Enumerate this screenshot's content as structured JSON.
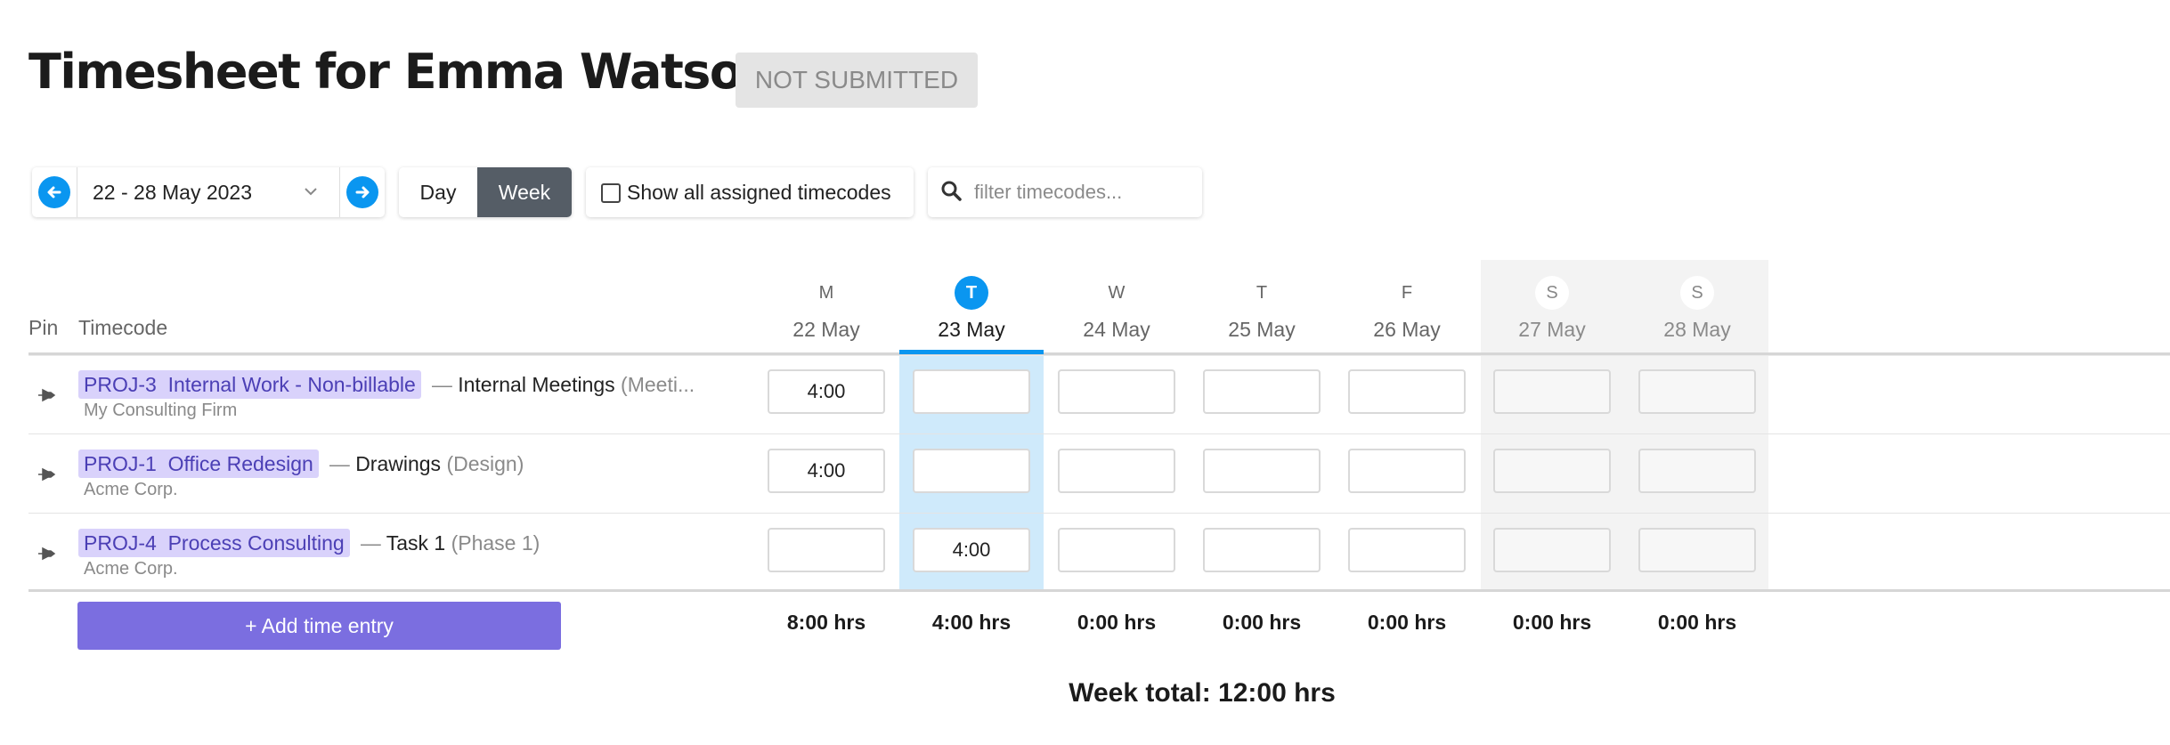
{
  "header": {
    "title": "Timesheet for Emma Watson",
    "status": "NOT SUBMITTED"
  },
  "toolbar": {
    "date_range": "22 - 28 May 2023",
    "view_day": "Day",
    "view_week": "Week",
    "active_view": "Week",
    "show_all_label": "Show all assigned timecodes",
    "show_all_checked": false,
    "filter_placeholder": "filter timecodes...",
    "filter_value": ""
  },
  "columns": {
    "pin": "Pin",
    "timecode": "Timecode"
  },
  "days": [
    {
      "letter": "M",
      "date": "22 May",
      "total": "8:00 hrs"
    },
    {
      "letter": "T",
      "date": "23 May",
      "total": "4:00 hrs",
      "today": true
    },
    {
      "letter": "W",
      "date": "24 May",
      "total": "0:00 hrs"
    },
    {
      "letter": "T",
      "date": "25 May",
      "total": "0:00 hrs"
    },
    {
      "letter": "F",
      "date": "26 May",
      "total": "0:00 hrs"
    },
    {
      "letter": "S",
      "date": "27 May",
      "total": "0:00 hrs",
      "weekend": true
    },
    {
      "letter": "S",
      "date": "28 May",
      "total": "0:00 hrs",
      "weekend": true
    }
  ],
  "rows": [
    {
      "project": "PROJ-3  Internal Work - Non-billable",
      "dash": "—",
      "task": "Internal Meetings",
      "phase": "(Meeti...",
      "client": "My Consulting Firm",
      "hours": [
        "4:00",
        "",
        "",
        "",
        "",
        "",
        ""
      ]
    },
    {
      "project": "PROJ-1  Office Redesign",
      "dash": "—",
      "task": "Drawings",
      "phase": "(Design)",
      "client": "Acme Corp.",
      "hours": [
        "4:00",
        "",
        "",
        "",
        "",
        "",
        ""
      ]
    },
    {
      "project": "PROJ-4  Process Consulting",
      "dash": "—",
      "task": "Task 1",
      "phase": "(Phase 1)",
      "client": "Acme Corp.",
      "hours": [
        "",
        "4:00",
        "",
        "",
        "",
        "",
        ""
      ]
    }
  ],
  "footer": {
    "add_entry": "+ Add time entry",
    "week_total": "Week total: 12:00 hrs"
  },
  "colors": {
    "accent": "#0a96f0",
    "today_highlight": "#cfeafb",
    "project_tag": "#d9d2fb",
    "add_button": "#7b6ee0",
    "active_toggle": "#555d66",
    "status_badge": "#e4e4e4"
  }
}
